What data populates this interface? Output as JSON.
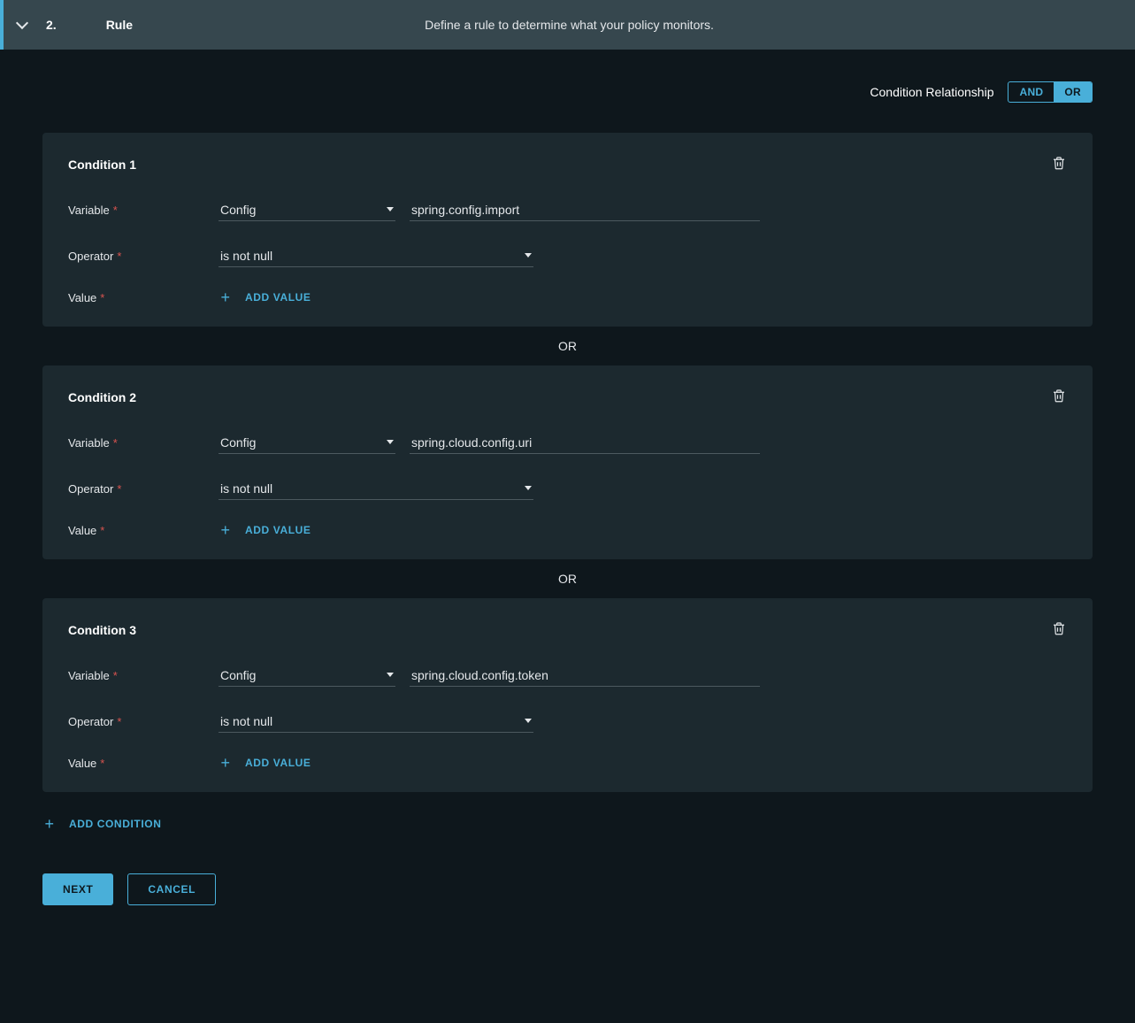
{
  "header": {
    "step_number": "2.",
    "step_title": "Rule",
    "step_description": "Define a rule to determine what your policy monitors."
  },
  "relationship": {
    "label": "Condition Relationship",
    "and_label": "AND",
    "or_label": "OR",
    "active": "OR"
  },
  "labels": {
    "variable": "Variable",
    "operator": "Operator",
    "value": "Value",
    "required_mark": "*",
    "add_value": "ADD VALUE",
    "add_condition": "ADD CONDITION",
    "next": "NEXT",
    "cancel": "CANCEL",
    "or_divider": "OR"
  },
  "conditions": [
    {
      "title": "Condition 1",
      "variable_select": "Config",
      "variable_value": "spring.config.import",
      "operator": "is not null"
    },
    {
      "title": "Condition 2",
      "variable_select": "Config",
      "variable_value": "spring.cloud.config.uri",
      "operator": "is not null"
    },
    {
      "title": "Condition 3",
      "variable_select": "Config",
      "variable_value": "spring.cloud.config.token",
      "operator": "is not null"
    }
  ]
}
